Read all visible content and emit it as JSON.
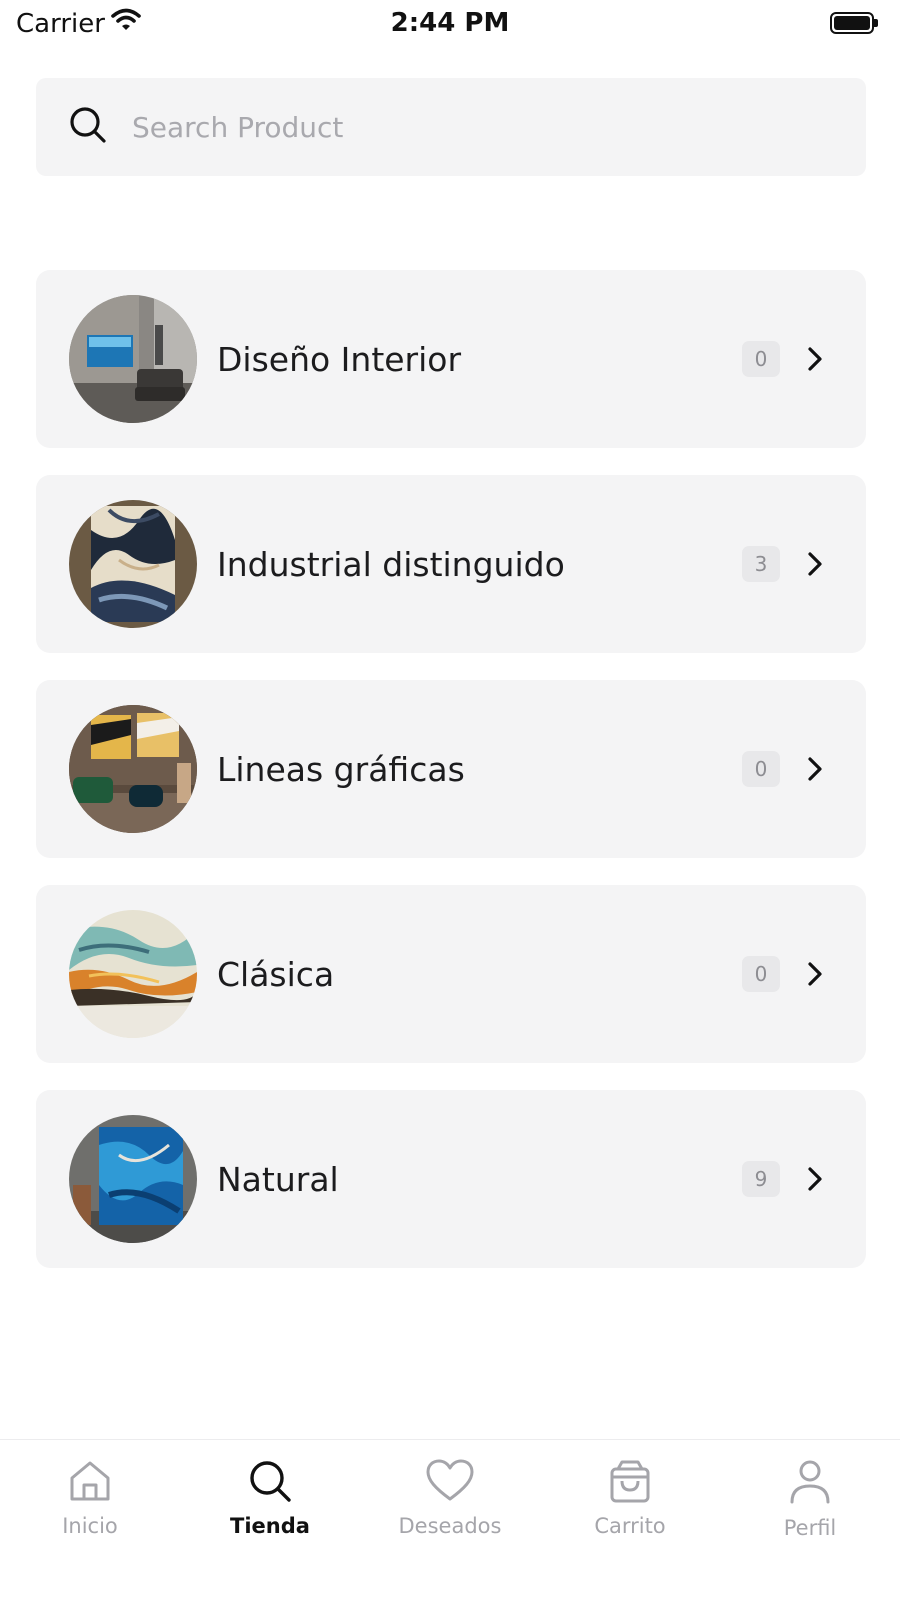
{
  "status_bar": {
    "carrier": "Carrier",
    "time": "2:44 PM"
  },
  "search": {
    "placeholder": "Search Product",
    "value": ""
  },
  "categories": [
    {
      "label": "Diseño Interior",
      "count": "0"
    },
    {
      "label": "Industrial distinguido",
      "count": "3"
    },
    {
      "label": "Lineas gráficas",
      "count": "0"
    },
    {
      "label": "Clásica",
      "count": "0"
    },
    {
      "label": "Natural",
      "count": "9"
    }
  ],
  "tab_bar": {
    "active": "Tienda",
    "items": [
      {
        "label": "Inicio",
        "icon": "home-icon"
      },
      {
        "label": "Tienda",
        "icon": "search-icon"
      },
      {
        "label": "Deseados",
        "icon": "heart-icon"
      },
      {
        "label": "Carrito",
        "icon": "bag-icon"
      },
      {
        "label": "Perfil",
        "icon": "user-icon"
      }
    ]
  },
  "colors": {
    "card_background": "#f4f4f5",
    "badge_background": "#e8e8ea",
    "active_tab": "#111111",
    "inactive_tab": "#a5a5aa"
  }
}
